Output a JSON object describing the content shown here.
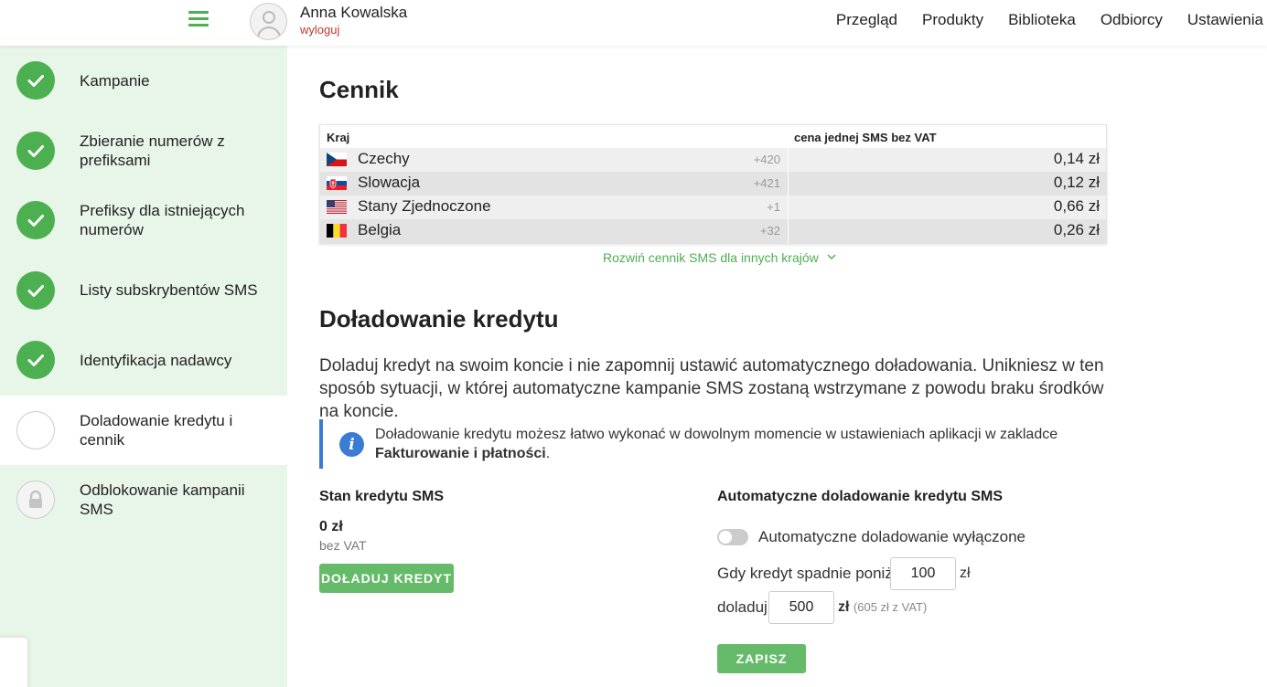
{
  "header": {
    "user_name": "Anna Kowalska",
    "logout_label": "wyloguj",
    "nav": [
      "Przegląd",
      "Produkty",
      "Biblioteka",
      "Odbiorcy",
      "Ustawienia"
    ]
  },
  "sidebar": {
    "steps": [
      {
        "label": "Kampanie",
        "state": "done"
      },
      {
        "label": "Zbieranie numerów z prefiksami",
        "state": "done"
      },
      {
        "label": "Prefiksy dla istniejących numerów",
        "state": "done"
      },
      {
        "label": "Listy subskrybentów SMS",
        "state": "done"
      },
      {
        "label": "Identyfikacja nadawcy",
        "state": "done"
      },
      {
        "label": "Doladowanie kredytu i cennik",
        "state": "active"
      },
      {
        "label": "Odblokowanie kampanii SMS",
        "state": "locked"
      }
    ]
  },
  "pricing": {
    "title": "Cennik",
    "col_country": "Kraj",
    "col_price": "cena jednej SMS bez VAT",
    "rows": [
      {
        "flag": "cz-flag-icon",
        "country": "Czechy",
        "prefix": "+420",
        "price": "0,14 zł"
      },
      {
        "flag": "sk-flag-icon",
        "country": "Slowacja",
        "prefix": "+421",
        "price": "0,12 zł"
      },
      {
        "flag": "us-flag-icon",
        "country": "Stany Zjednoczone",
        "prefix": "+1",
        "price": "0,66 zł"
      },
      {
        "flag": "be-flag-icon",
        "country": "Belgia",
        "prefix": "+32",
        "price": "0,26 zł"
      }
    ],
    "expand_label": "Rozwiń cennik SMS dla innych krajów"
  },
  "topup": {
    "title": "Doładowanie kredytu",
    "description": "Doladuj kredyt na swoim koncie i nie zapomnij ustawić automatycznego doładowania. Unikniesz w ten sposób sytuacji, w której automatyczne kampanie SMS zostaną wstrzymane z powodu braku środków na koncie.",
    "info_text": "Doładowanie kredytu możesz łatwo wykonać w dowolnym momencie w ustawieniach aplikacji w zakladce",
    "info_bold": "Fakturowanie i płatności",
    "info_end": ".",
    "balance_title": "Stan kredytu SMS",
    "balance_amount": "0 zł",
    "balance_vat": "bez VAT",
    "topup_button": "DOŁADUJ KREDYT"
  },
  "auto_topup": {
    "title": "Automatyczne doladowanie kredytu SMS",
    "toggle_label": "Automatyczne doladowanie wyłączone",
    "toggle_on": false,
    "threshold_label": "Gdy kredyt spadnie poniżej",
    "threshold_value": "100",
    "threshold_unit": "zł",
    "amount_label": "doladuj",
    "amount_value": "500",
    "amount_unit": "zł",
    "amount_note": "(605 zł z VAT)",
    "save_button": "ZAPISZ"
  },
  "colors": {
    "accent_green": "#4caf50",
    "sidebar_bg": "#e8f5e9",
    "info_blue": "#3a7bd5",
    "logout_red": "#c0392b"
  }
}
